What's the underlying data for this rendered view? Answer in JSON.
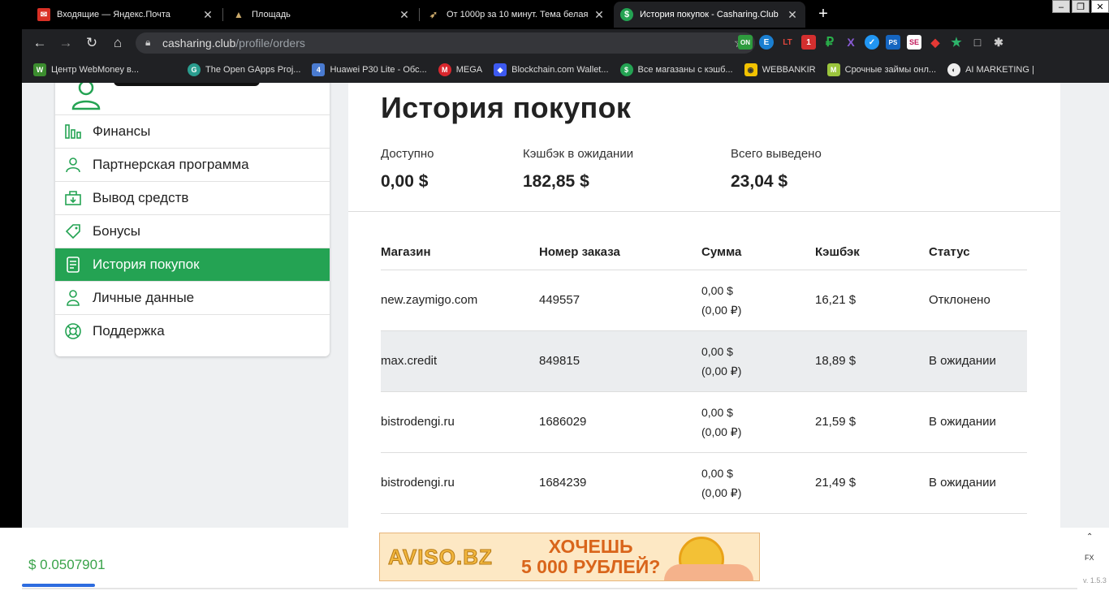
{
  "browser": {
    "tabs": [
      {
        "title": "Входящие — Яндекс.Почта",
        "icon": "mail-icon"
      },
      {
        "title": "Площадь",
        "icon": "pyramid-icon"
      },
      {
        "title": "От 1000р за 10 минут. Тема белая",
        "icon": "feather-icon"
      },
      {
        "title": "История покупок - Casharing.Club",
        "icon": "dollar-icon",
        "active": true
      }
    ],
    "url_host": "casharing.club",
    "url_path": "/profile/orders",
    "bookmarks": [
      {
        "label": "Центр WebMoney в..."
      },
      {
        "label": "The Open GApps Proj..."
      },
      {
        "label": "Huawei P30 Lite - Обс..."
      },
      {
        "label": "MEGA"
      },
      {
        "label": "Blockchain.com Wallet..."
      },
      {
        "label": "Все магазаны с кэшб..."
      },
      {
        "label": "WEBBANKIR"
      },
      {
        "label": "Срочные займы онл..."
      },
      {
        "label": "AI MARKETING |"
      }
    ],
    "extensions": [
      "ON",
      "E",
      "LT",
      "1",
      "₽",
      "X",
      "✓",
      "PS",
      "SE",
      "◆",
      "★",
      "□",
      "✱"
    ]
  },
  "sidebar": {
    "items": [
      {
        "label": "Финансы",
        "icon": "bar-chart-icon"
      },
      {
        "label": "Партнерская программа",
        "icon": "users-icon"
      },
      {
        "label": "Вывод средств",
        "icon": "wallet-icon"
      },
      {
        "label": "Бонусы",
        "icon": "tag-icon"
      },
      {
        "label": "История покупок",
        "icon": "receipt-icon",
        "active": true
      },
      {
        "label": "Личные данные",
        "icon": "user-icon"
      },
      {
        "label": "Поддержка",
        "icon": "lifebuoy-icon"
      }
    ]
  },
  "main": {
    "title": "История покупок",
    "stats": [
      {
        "label": "Доступно",
        "value": "0,00 $"
      },
      {
        "label": "Кэшбэк в ожидании",
        "value": "182,85 $"
      },
      {
        "label": "Всего выведено",
        "value": "23,04 $"
      }
    ],
    "table": {
      "headers": [
        "Магазин",
        "Номер заказа",
        "Сумма",
        "Кэшбэк",
        "Статус"
      ],
      "rows": [
        {
          "shop": "new.zaymigo.com",
          "order": "449557",
          "sum": "0,00 $",
          "sum_rub": "(0,00 ₽)",
          "cashback": "16,21 $",
          "status": "Отклонено"
        },
        {
          "shop": "max.credit",
          "order": "849815",
          "sum": "0,00 $",
          "sum_rub": "(0,00 ₽)",
          "cashback": "18,89 $",
          "status": "В ожидании"
        },
        {
          "shop": "bistrodengi.ru",
          "order": "1686029",
          "sum": "0,00 $",
          "sum_rub": "(0,00 ₽)",
          "cashback": "21,59 $",
          "status": "В ожидании"
        },
        {
          "shop": "bistrodengi.ru",
          "order": "1684239",
          "sum": "0,00 $",
          "sum_rub": "(0,00 ₽)",
          "cashback": "21,49 $",
          "status": "В ожидании"
        }
      ]
    }
  },
  "bottom": {
    "balance": "$ 0.0507901",
    "banner_logo": "AVISO.BZ",
    "banner_line1": "ХОЧЕШЬ",
    "banner_line2": "5 000 РУБЛЕЙ?",
    "side_fx": "FX",
    "side_version": "v. 1.5.3"
  },
  "colors": {
    "accent": "#24a353",
    "balance": "#3aa34a",
    "banner_text": "#d9651b"
  }
}
